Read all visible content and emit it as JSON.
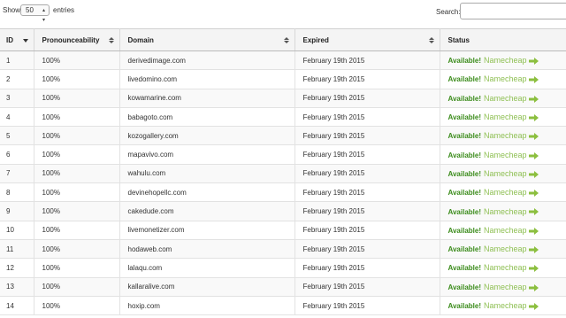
{
  "controls": {
    "show_label": "Show",
    "entries_value": "50",
    "entries_label": "entries",
    "search_label": "Search:",
    "search_value": ""
  },
  "table": {
    "headers": {
      "id": "ID",
      "pronounceability": "Pronounceability",
      "domain": "Domain",
      "expired": "Expired",
      "status": "Status"
    },
    "rows": [
      {
        "id": "1",
        "pronounceability": "100%",
        "domain": "derivedimage.com",
        "expired": "February 19th 2015",
        "status": "Available!",
        "registrar": "Namecheap"
      },
      {
        "id": "2",
        "pronounceability": "100%",
        "domain": "livedomino.com",
        "expired": "February 19th 2015",
        "status": "Available!",
        "registrar": "Namecheap"
      },
      {
        "id": "3",
        "pronounceability": "100%",
        "domain": "kowamarine.com",
        "expired": "February 19th 2015",
        "status": "Available!",
        "registrar": "Namecheap"
      },
      {
        "id": "4",
        "pronounceability": "100%",
        "domain": "babagoto.com",
        "expired": "February 19th 2015",
        "status": "Available!",
        "registrar": "Namecheap"
      },
      {
        "id": "5",
        "pronounceability": "100%",
        "domain": "kozogallery.com",
        "expired": "February 19th 2015",
        "status": "Available!",
        "registrar": "Namecheap"
      },
      {
        "id": "6",
        "pronounceability": "100%",
        "domain": "mapavivo.com",
        "expired": "February 19th 2015",
        "status": "Available!",
        "registrar": "Namecheap"
      },
      {
        "id": "7",
        "pronounceability": "100%",
        "domain": "wahulu.com",
        "expired": "February 19th 2015",
        "status": "Available!",
        "registrar": "Namecheap"
      },
      {
        "id": "8",
        "pronounceability": "100%",
        "domain": "devinehopellc.com",
        "expired": "February 19th 2015",
        "status": "Available!",
        "registrar": "Namecheap"
      },
      {
        "id": "9",
        "pronounceability": "100%",
        "domain": "cakedude.com",
        "expired": "February 19th 2015",
        "status": "Available!",
        "registrar": "Namecheap"
      },
      {
        "id": "10",
        "pronounceability": "100%",
        "domain": "livemonetizer.com",
        "expired": "February 19th 2015",
        "status": "Available!",
        "registrar": "Namecheap"
      },
      {
        "id": "11",
        "pronounceability": "100%",
        "domain": "hodaweb.com",
        "expired": "February 19th 2015",
        "status": "Available!",
        "registrar": "Namecheap"
      },
      {
        "id": "12",
        "pronounceability": "100%",
        "domain": "lalaqu.com",
        "expired": "February 19th 2015",
        "status": "Available!",
        "registrar": "Namecheap"
      },
      {
        "id": "13",
        "pronounceability": "100%",
        "domain": "kallaralive.com",
        "expired": "February 19th 2015",
        "status": "Available!",
        "registrar": "Namecheap"
      },
      {
        "id": "14",
        "pronounceability": "100%",
        "domain": "hoxip.com",
        "expired": "February 19th 2015",
        "status": "Available!",
        "registrar": "Namecheap"
      }
    ]
  },
  "colors": {
    "available": "#3c8c1c",
    "namecheap": "#8fc054",
    "arrow": "#8cbf3f"
  },
  "icons": {
    "sort_active": "sort-desc-icon",
    "sort": "sort-both-icon",
    "arrow": "arrow-right-icon",
    "select_caret": "chevron-updown-icon"
  }
}
